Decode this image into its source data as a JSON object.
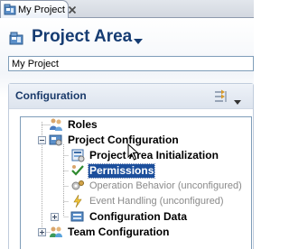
{
  "tab": {
    "label": "My Project",
    "icon": "project-area-icon",
    "close_icon": "close-icon"
  },
  "header": {
    "title": "Project Area",
    "title_menu_icon": "chevron-down-icon",
    "name_field": {
      "value": "My Project",
      "placeholder": ""
    }
  },
  "section": {
    "title": "Configuration",
    "toolbar_icon": "layout-toggle-icon",
    "menu_icon": "view-menu-chevron-icon"
  },
  "tree": {
    "nodes": [
      {
        "label": "Roles",
        "icon": "roles-icon",
        "style": "bold"
      },
      {
        "label": "Project Configuration",
        "icon": "project-config-icon",
        "style": "bold",
        "expanded": true
      },
      {
        "label": "Project Area Initialization",
        "icon": "initialization-icon",
        "style": "bold"
      },
      {
        "label": "Permissions",
        "icon": "permissions-check-icon",
        "style": "bold",
        "selected": true
      },
      {
        "label": "Operation Behavior (unconfigured)",
        "icon": "operation-behavior-icon",
        "style": "disabled"
      },
      {
        "label": "Event Handling (unconfigured)",
        "icon": "event-handling-icon",
        "style": "disabled"
      },
      {
        "label": "Configuration Data",
        "icon": "configuration-data-icon",
        "style": "bold",
        "expanded": false
      },
      {
        "label": "Team Configuration",
        "icon": "team-config-icon",
        "style": "bold",
        "expanded": false
      }
    ]
  },
  "colors": {
    "title": "#163c72",
    "section_title": "#1a3a6a",
    "selection": "#1c4f9c",
    "disabled_text": "#8a8a8a"
  }
}
